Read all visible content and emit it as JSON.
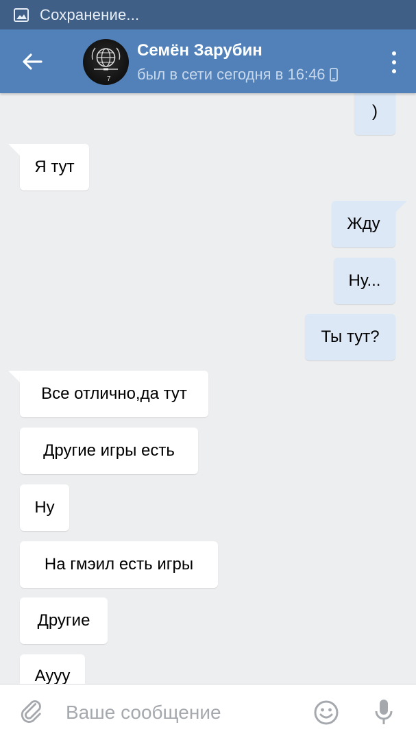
{
  "status_bar": {
    "text": "Сохранение..."
  },
  "header": {
    "contact_name": "Семён Зарубин",
    "last_seen": "был в сети сегодня в 16:46",
    "avatar_text": "7"
  },
  "messages": [
    {
      "direction": "out",
      "text": ")"
    },
    {
      "direction": "in",
      "text": "Я тут"
    },
    {
      "direction": "out",
      "text": "Жду"
    },
    {
      "direction": "out",
      "text": "Ну..."
    },
    {
      "direction": "out",
      "text": "Ты тут?"
    },
    {
      "direction": "in",
      "text": "Все отлично,да тут"
    },
    {
      "direction": "in",
      "text": "Другие игры есть"
    },
    {
      "direction": "in",
      "text": "Ну"
    },
    {
      "direction": "in",
      "text": "На гмэил есть игры"
    },
    {
      "direction": "in",
      "text": "Другие"
    },
    {
      "direction": "in",
      "text": "Ауyy"
    }
  ],
  "input": {
    "placeholder": "Ваше сообщение",
    "value": ""
  },
  "colors": {
    "status_bar": "#3f5f87",
    "header": "#5181b8",
    "background": "#edeef0",
    "incoming_bubble": "#ffffff",
    "outgoing_bubble": "#dce8f6"
  },
  "icons": {
    "status": "image-icon",
    "back": "arrow-back-icon",
    "phone": "phone-icon",
    "menu": "more-vert-icon",
    "attach": "paperclip-icon",
    "emoji": "smiley-icon",
    "mic": "microphone-icon"
  }
}
